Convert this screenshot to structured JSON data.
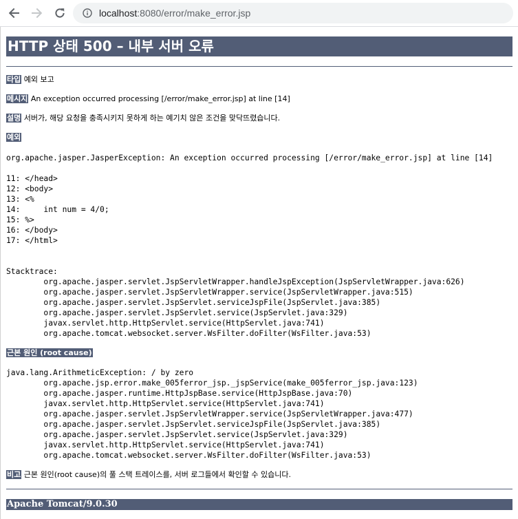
{
  "browser": {
    "url_host": "localhost",
    "url_path": ":8080/error/make_error.jsp"
  },
  "page": {
    "title": "HTTP 상태 500 – 내부 서버 오류",
    "type_label": "타입",
    "type_value": " 예외 보고",
    "message_label": "메시지",
    "message_value": " An exception occurred processing [/error/make_error.jsp] at line [14]",
    "description_label": "설명",
    "description_value": " 서버가, 해당 요청을 충족시키지 못하게 하는 예기치 않은 조건을 맞닥뜨렸습니다.",
    "exception_label": "예외",
    "exception_text": "org.apache.jasper.JasperException: An exception occurred processing [/error/make_error.jsp] at line [14]\n\n11: </head>\n12: <body>\n13: <%\n14:     int num = 4/0;\n15: %>\n16: </body>\n17: </html>\n\n\nStacktrace:\n\torg.apache.jasper.servlet.JspServletWrapper.handleJspException(JspServletWrapper.java:626)\n\torg.apache.jasper.servlet.JspServletWrapper.service(JspServletWrapper.java:515)\n\torg.apache.jasper.servlet.JspServlet.serviceJspFile(JspServlet.java:385)\n\torg.apache.jasper.servlet.JspServlet.service(JspServlet.java:329)\n\tjavax.servlet.http.HttpServlet.service(HttpServlet.java:741)\n\torg.apache.tomcat.websocket.server.WsFilter.doFilter(WsFilter.java:53)",
    "root_cause_label": "근본 원인 (root cause)",
    "root_cause_text": "java.lang.ArithmeticException: / by zero\n\torg.apache.jsp.error.make_005ferror_jsp._jspService(make_005ferror_jsp.java:123)\n\torg.apache.jasper.runtime.HttpJspBase.service(HttpJspBase.java:70)\n\tjavax.servlet.http.HttpServlet.service(HttpServlet.java:741)\n\torg.apache.jasper.servlet.JspServletWrapper.service(JspServletWrapper.java:477)\n\torg.apache.jasper.servlet.JspServlet.serviceJspFile(JspServlet.java:385)\n\torg.apache.jasper.servlet.JspServlet.service(JspServlet.java:329)\n\tjavax.servlet.http.HttpServlet.service(HttpServlet.java:741)\n\torg.apache.tomcat.websocket.server.WsFilter.doFilter(WsFilter.java:53)",
    "note_label": "비고",
    "note_value": " 근본 원인(root cause)의 풀 스택 트레이스를, 서버 로그들에서 확인할 수 있습니다.",
    "footer": "Apache Tomcat/9.0.30"
  },
  "colors": {
    "header_bg": "#525d76",
    "header_fg": "#ffffff"
  },
  "icons": {
    "back": "arrow-left-icon",
    "forward": "arrow-right-icon",
    "reload": "reload-icon",
    "site_info": "info-icon"
  }
}
